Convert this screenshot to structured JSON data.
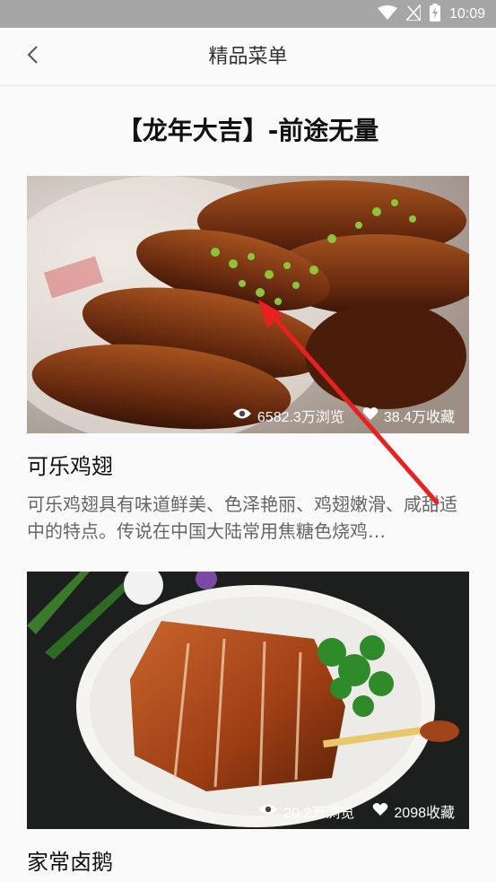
{
  "status_bar": {
    "time": "10:09"
  },
  "app_bar": {
    "title": "精品菜单"
  },
  "menu": {
    "heading": "【龙年大吉】-前途无量"
  },
  "dishes": [
    {
      "title": "可乐鸡翅",
      "views": "6582.3万浏览",
      "favorites": "38.4万收藏",
      "description": "可乐鸡翅具有味道鲜美、色泽艳丽、鸡翅嫩滑、咸甜适中的特点。传说在中国大陆常用焦糖色烧鸡…"
    },
    {
      "title": "家常卤鹅",
      "views": "20.2万浏览",
      "favorites": "2098收藏",
      "description": ""
    }
  ],
  "colors": {
    "status_bar": "#a6a6a6",
    "arrow": "#e8201f"
  },
  "icons": [
    "wifi-icon",
    "no-signal-icon",
    "battery-charging-icon",
    "back-chevron-icon",
    "eye-icon",
    "heart-icon"
  ]
}
